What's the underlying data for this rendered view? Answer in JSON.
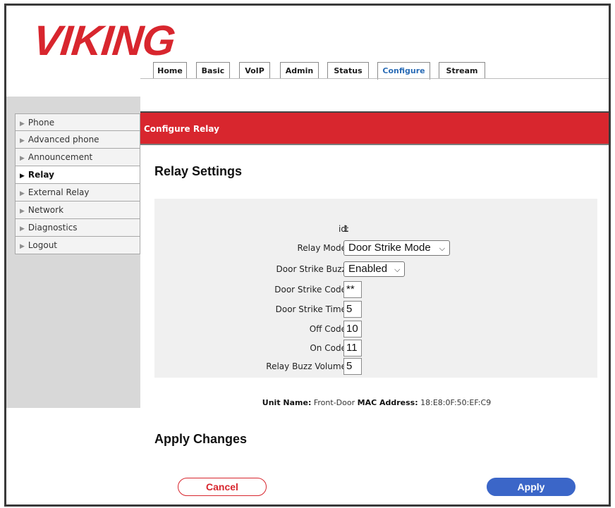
{
  "logo": "VIKING",
  "tabs": [
    {
      "label": "Home"
    },
    {
      "label": "Basic"
    },
    {
      "label": "VoIP"
    },
    {
      "label": "Admin"
    },
    {
      "label": "Status"
    },
    {
      "label": "Configure",
      "active": true
    },
    {
      "label": "Stream"
    }
  ],
  "nav": [
    {
      "label": "Phone"
    },
    {
      "label": "Advanced phone"
    },
    {
      "label": "Announcement"
    },
    {
      "label": "Relay",
      "active": true
    },
    {
      "label": "External Relay"
    },
    {
      "label": "Network"
    },
    {
      "label": "Diagnostics"
    },
    {
      "label": "Logout"
    }
  ],
  "section_title": "Configure Relay",
  "settings_heading": "Relay Settings",
  "form": {
    "id_label": "id:",
    "id_value": "1",
    "relay_mode_label": "Relay Mode:",
    "relay_mode_value": "Door Strike Mode",
    "door_strike_buzz_label": "Door Strike Buzz:",
    "door_strike_buzz_value": "Enabled",
    "door_strike_code_label": "Door Strike Code:",
    "door_strike_code_value": "**",
    "door_strike_time_label": "Door Strike Time:",
    "door_strike_time_value": "5",
    "off_code_label": "Off Code:",
    "off_code_value": "10",
    "on_code_label": "On Code:",
    "on_code_value": "11",
    "relay_buzz_volume_label": "Relay Buzz Volume:",
    "relay_buzz_volume_value": "5"
  },
  "unit_info": {
    "unit_name_label": "Unit Name:",
    "unit_name_value": "Front-Door",
    "mac_label": "MAC Address:",
    "mac_value": "18:E8:0F:50:EF:C9"
  },
  "apply_heading": "Apply Changes",
  "buttons": {
    "cancel": "Cancel",
    "apply": "Apply"
  },
  "colors": {
    "brand_red": "#d8262e",
    "apply_blue": "#3b66c8",
    "active_tab": "#2a6cb6"
  }
}
